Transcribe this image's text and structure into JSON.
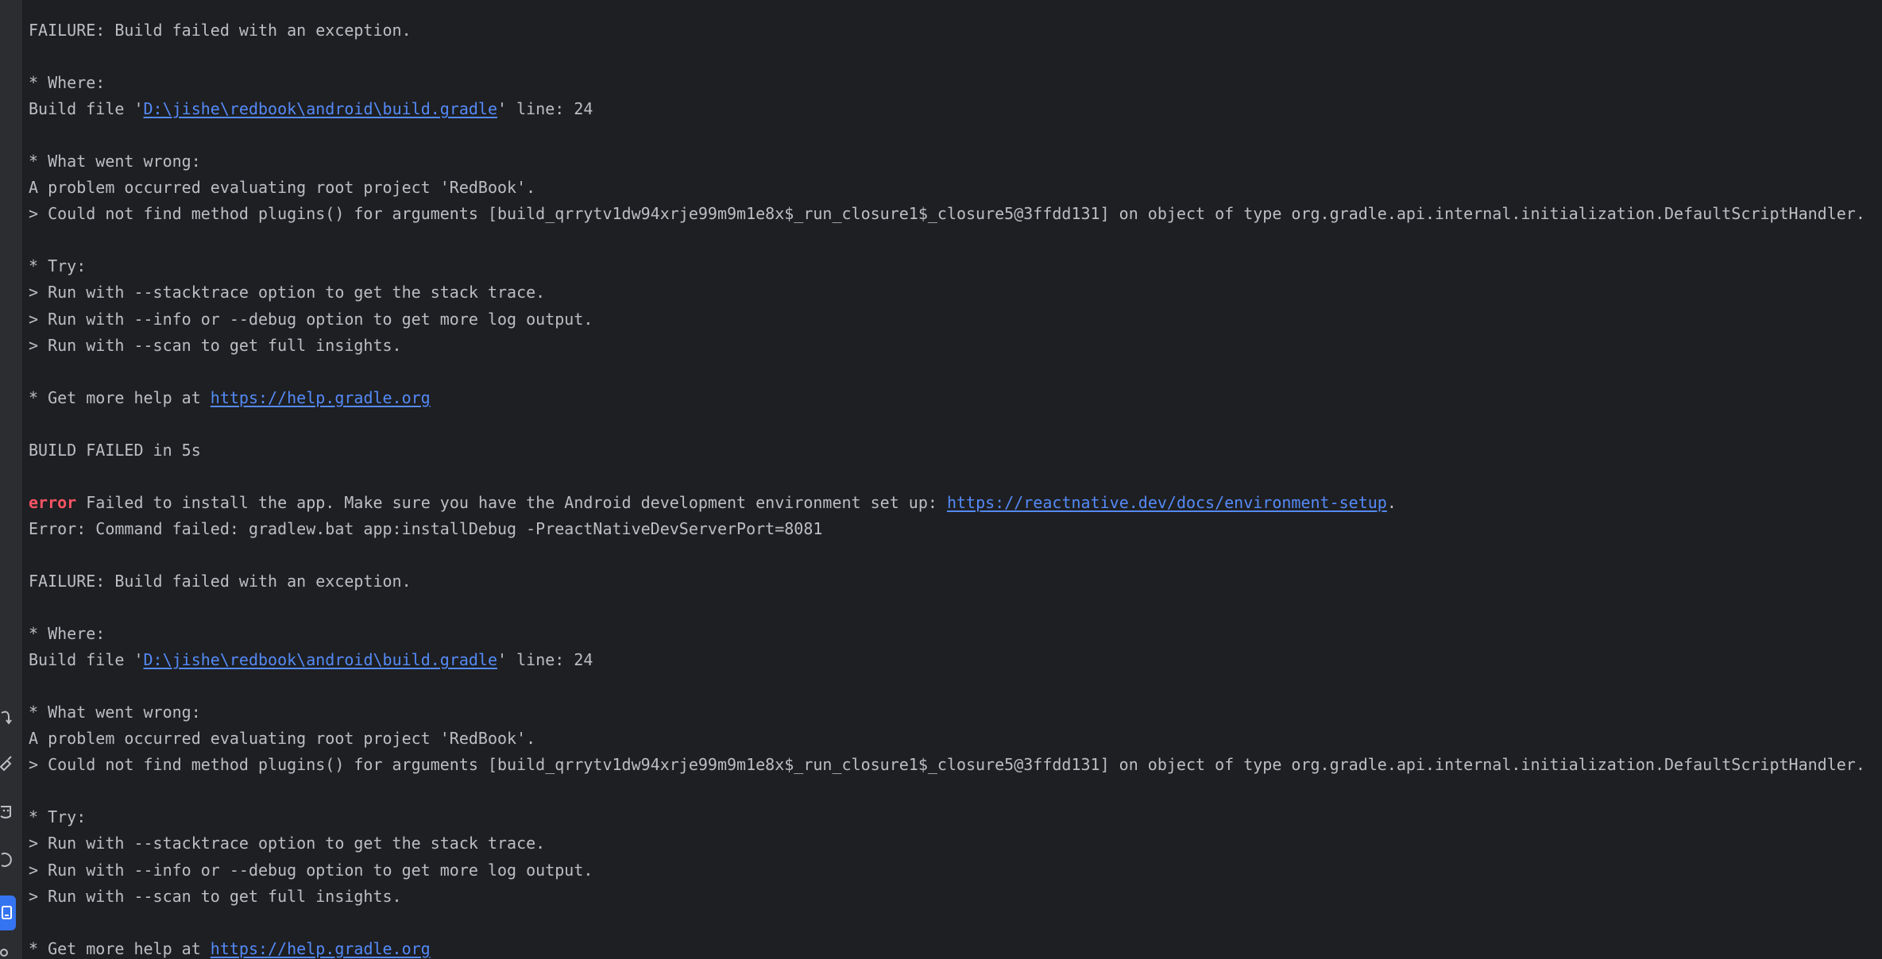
{
  "console": {
    "lines": [
      {
        "type": "text",
        "text": "FAILURE: Build failed with an exception."
      },
      {
        "type": "blank"
      },
      {
        "type": "text",
        "text": "* Where:"
      },
      {
        "type": "link",
        "before": "Build file '",
        "link": "D:\\jishe\\redbook\\android\\build.gradle",
        "after": "' line: 24"
      },
      {
        "type": "blank"
      },
      {
        "type": "text",
        "text": "* What went wrong:"
      },
      {
        "type": "text",
        "text": "A problem occurred evaluating root project 'RedBook'."
      },
      {
        "type": "text",
        "text": "> Could not find method plugins() for arguments [build_qrrytv1dw94xrje99m9m1e8x$_run_closure1$_closure5@3ffdd131] on object of type org.gradle.api.internal.initialization.DefaultScriptHandler."
      },
      {
        "type": "blank"
      },
      {
        "type": "text",
        "text": "* Try:"
      },
      {
        "type": "text",
        "text": "> Run with --stacktrace option to get the stack trace."
      },
      {
        "type": "text",
        "text": "> Run with --info or --debug option to get more log output."
      },
      {
        "type": "text",
        "text": "> Run with --scan to get full insights."
      },
      {
        "type": "blank"
      },
      {
        "type": "link",
        "before": "* Get more help at ",
        "link": "https://help.gradle.org",
        "after": ""
      },
      {
        "type": "blank"
      },
      {
        "type": "text",
        "text": "BUILD FAILED in 5s"
      },
      {
        "type": "blank"
      },
      {
        "type": "error",
        "tag": "error",
        "before": " Failed to install the app. Make sure you have the Android development environment set up: ",
        "link": "https://reactnative.dev/docs/environment-setup",
        "after": "."
      },
      {
        "type": "text",
        "text": "Error: Command failed: gradlew.bat app:installDebug -PreactNativeDevServerPort=8081"
      },
      {
        "type": "blank"
      },
      {
        "type": "text",
        "text": "FAILURE: Build failed with an exception."
      },
      {
        "type": "blank"
      },
      {
        "type": "text",
        "text": "* Where:"
      },
      {
        "type": "link",
        "before": "Build file '",
        "link": "D:\\jishe\\redbook\\android\\build.gradle",
        "after": "' line: 24"
      },
      {
        "type": "blank"
      },
      {
        "type": "text",
        "text": "* What went wrong:"
      },
      {
        "type": "text",
        "text": "A problem occurred evaluating root project 'RedBook'."
      },
      {
        "type": "text",
        "text": "> Could not find method plugins() for arguments [build_qrrytv1dw94xrje99m9m1e8x$_run_closure1$_closure5@3ffdd131] on object of type org.gradle.api.internal.initialization.DefaultScriptHandler."
      },
      {
        "type": "blank"
      },
      {
        "type": "text",
        "text": "* Try:"
      },
      {
        "type": "text",
        "text": "> Run with --stacktrace option to get the stack trace."
      },
      {
        "type": "text",
        "text": "> Run with --info or --debug option to get more log output."
      },
      {
        "type": "text",
        "text": "> Run with --scan to get full insights."
      },
      {
        "type": "blank"
      },
      {
        "type": "link",
        "before": "* Get more help at ",
        "link": "https://help.gradle.org",
        "after": ""
      }
    ]
  },
  "sidebar": {
    "icons": [
      "undo-icon",
      "build-hammer-icon",
      "profiler-icon",
      "refresh-icon",
      "terminal-icon",
      "git-branch-icon"
    ],
    "active_icon": "terminal-icon"
  },
  "colors": {
    "background": "#1e1f22",
    "text": "#bcbec4",
    "link": "#548af7",
    "error": "#f75464",
    "accent": "#3574f0"
  }
}
